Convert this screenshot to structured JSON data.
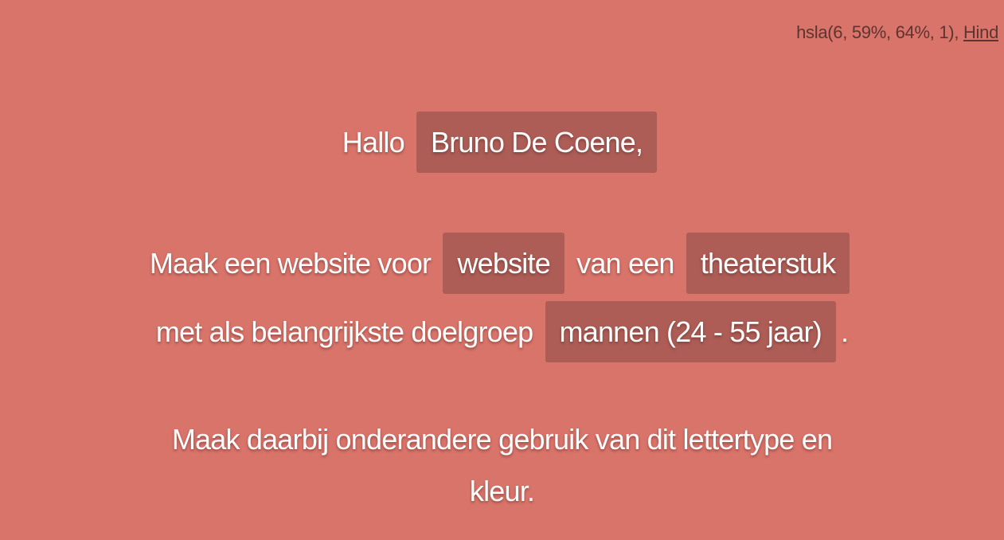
{
  "colors": {
    "background": "#d9746a",
    "chip": "#ad5d56",
    "text": "#ffffff",
    "info_text": "#5e3430"
  },
  "info": {
    "color_value": "hsla(6, 59%, 64%, 1),",
    "font_link": "Hind"
  },
  "greeting": {
    "hello": "Hallo",
    "name": "Bruno De Coene,"
  },
  "brief": {
    "part1": "Maak een website voor",
    "project": "website",
    "part2": "van een",
    "subject": "theaterstuk",
    "part3": "met als belangrijkste doelgroep",
    "audience": "mannen (24 - 55 jaar)",
    "end": "."
  },
  "instruction": {
    "line1": "Maak daarbij onderandere gebruik van dit lettertype en",
    "line2": "kleur."
  }
}
